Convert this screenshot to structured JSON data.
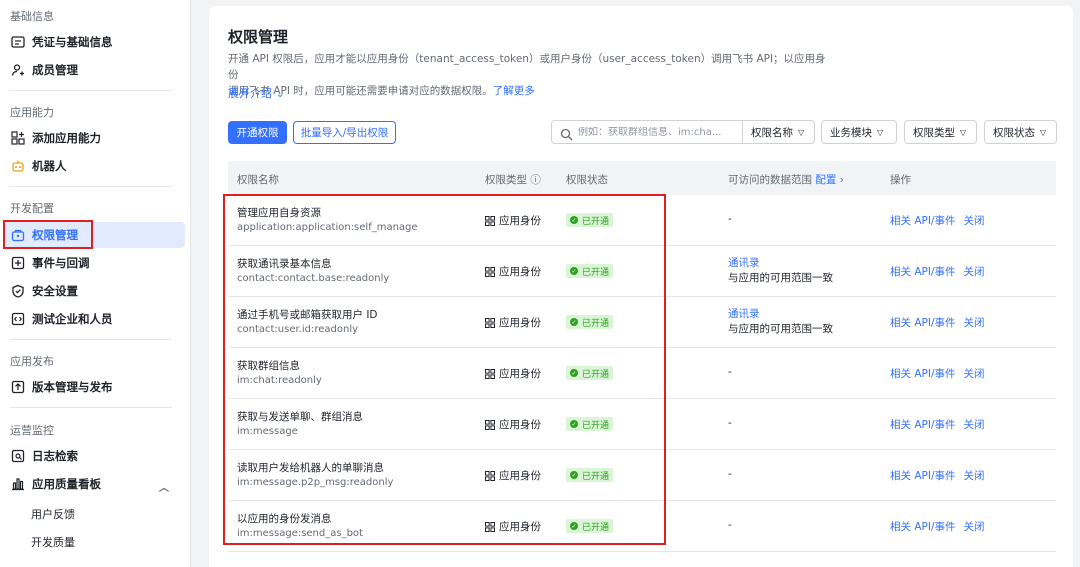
{
  "sidebar": {
    "sections": [
      {
        "title": "基础信息",
        "items": [
          "凭证与基础信息",
          "成员管理"
        ]
      },
      {
        "title": "应用能力",
        "items": [
          "添加应用能力",
          "机器人"
        ]
      },
      {
        "title": "开发配置",
        "items": [
          "权限管理",
          "事件与回调",
          "安全设置",
          "测试企业和人员"
        ]
      },
      {
        "title": "应用发布",
        "items": [
          "版本管理与发布"
        ]
      },
      {
        "title": "运营监控",
        "items": [
          "日志检索",
          "应用质量看板"
        ],
        "subitems": [
          "用户反馈",
          "开发质量"
        ]
      }
    ]
  },
  "main": {
    "title": "权限管理",
    "desc_line1": "开通 API 权限后，应用才能以应用身份（tenant_access_token）或用户身份（user_access_token）调用飞书 API；以应用身份",
    "desc_line2": "调用飞书 API 时，应用可能还需要申请对应的数据权限。",
    "learn_more": "了解更多",
    "expand": "展开介绍",
    "btn_open": "开通权限",
    "btn_batch": "批量导入/导出权限",
    "search_placeholder": "例如：获取群组信息、im:cha...",
    "filters": [
      "权限名称",
      "业务模块",
      "权限类型",
      "权限状态"
    ],
    "headers": {
      "name": "权限名称",
      "type": "权限类型",
      "status": "权限状态",
      "scope": "可访问的数据范围",
      "scope_link": "配置",
      "ops": "操作"
    },
    "rows": [
      {
        "name": "管理应用自身资源",
        "code": "application:application:self_manage",
        "type": "应用身份",
        "status": "已开通",
        "scope": "-",
        "scope_link": "",
        "scope_note": "",
        "op1": "相关 API/事件",
        "op2": "关闭"
      },
      {
        "name": "获取通讯录基本信息",
        "code": "contact:contact.base:readonly",
        "type": "应用身份",
        "status": "已开通",
        "scope": "",
        "scope_link": "通讯录",
        "scope_note": "与应用的可用范围一致",
        "op1": "相关 API/事件",
        "op2": "关闭"
      },
      {
        "name": "通过手机号或邮箱获取用户 ID",
        "code": "contact:user.id:readonly",
        "type": "应用身份",
        "status": "已开通",
        "scope": "",
        "scope_link": "通讯录",
        "scope_note": "与应用的可用范围一致",
        "op1": "相关 API/事件",
        "op2": "关闭"
      },
      {
        "name": "获取群组信息",
        "code": "im:chat:readonly",
        "type": "应用身份",
        "status": "已开通",
        "scope": "-",
        "scope_link": "",
        "scope_note": "",
        "op1": "相关 API/事件",
        "op2": "关闭"
      },
      {
        "name": "获取与发送单聊、群组消息",
        "code": "im:message",
        "type": "应用身份",
        "status": "已开通",
        "scope": "-",
        "scope_link": "",
        "scope_note": "",
        "op1": "相关 API/事件",
        "op2": "关闭"
      },
      {
        "name": "读取用户发给机器人的单聊消息",
        "code": "im:message.p2p_msg:readonly",
        "type": "应用身份",
        "status": "已开通",
        "scope": "-",
        "scope_link": "",
        "scope_note": "",
        "op1": "相关 API/事件",
        "op2": "关闭"
      },
      {
        "name": "以应用的身份发消息",
        "code": "im:message:send_as_bot",
        "type": "应用身份",
        "status": "已开通",
        "scope": "-",
        "scope_link": "",
        "scope_note": "",
        "op1": "相关 API/事件",
        "op2": "关闭"
      }
    ]
  }
}
